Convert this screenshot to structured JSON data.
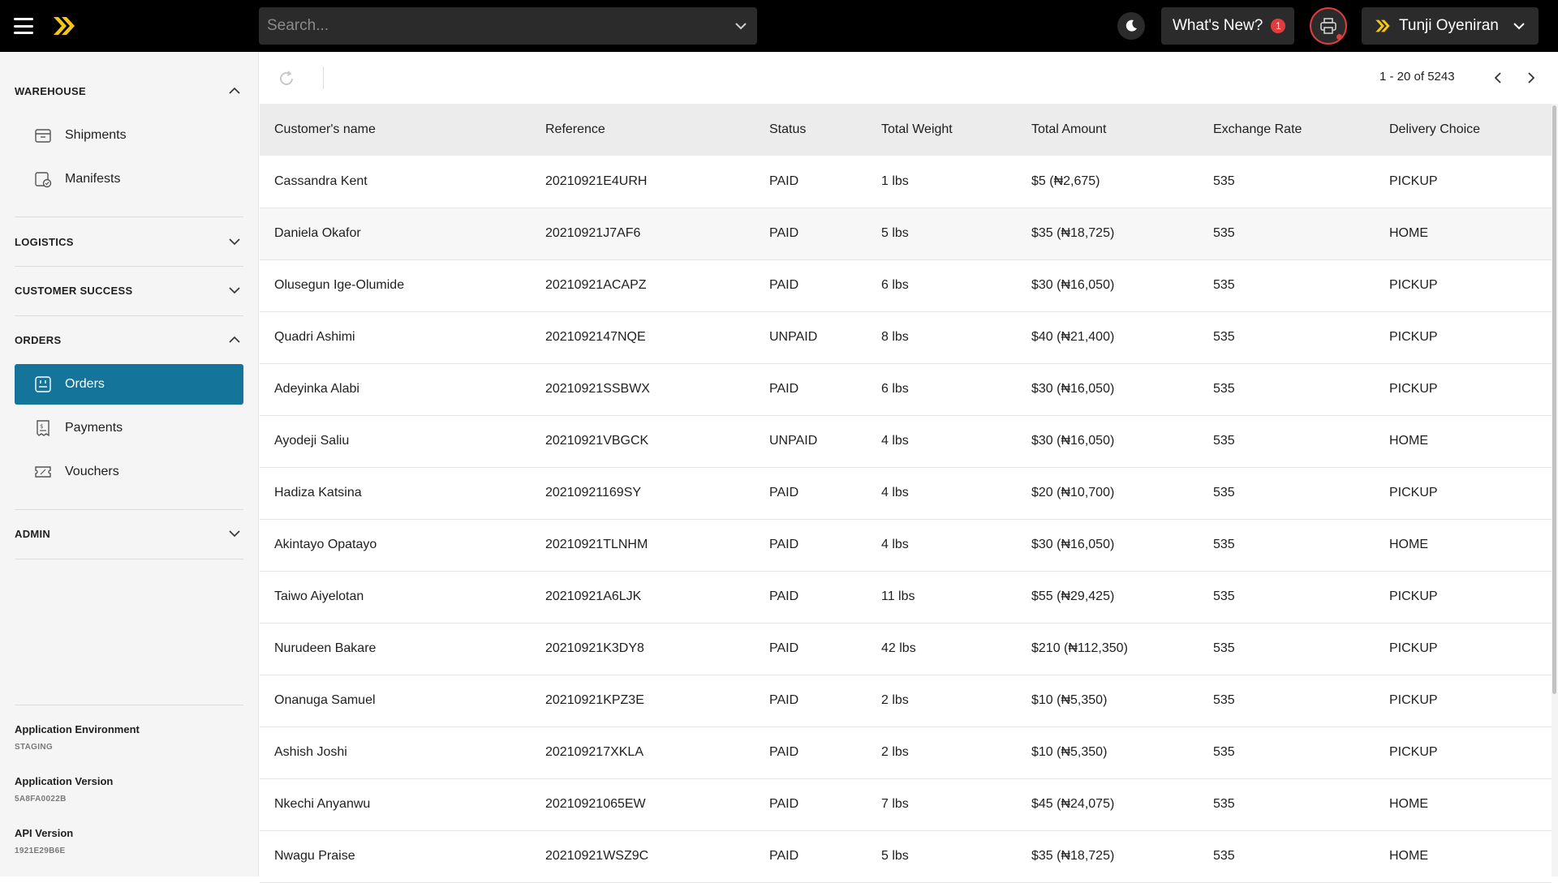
{
  "header": {
    "search_placeholder": "Search...",
    "whats_new_label": "What's New?",
    "whats_new_count": "1",
    "user_name": "Tunji Oyeniran"
  },
  "sidebar": {
    "sections": {
      "warehouse": "WAREHOUSE",
      "logistics": "LOGISTICS",
      "customer_success": "CUSTOMER SUCCESS",
      "orders": "ORDERS",
      "admin": "ADMIN"
    },
    "items": {
      "shipments": "Shipments",
      "manifests": "Manifests",
      "orders": "Orders",
      "payments": "Payments",
      "vouchers": "Vouchers"
    },
    "footer": {
      "env_label": "Application Environment",
      "env_value": "STAGING",
      "version_label": "Application Version",
      "version_value": "5A8FA0022B",
      "api_label": "API Version",
      "api_value": "1921E29B6E"
    }
  },
  "pager": {
    "text": "1 - 20 of 5243"
  },
  "table": {
    "columns": [
      "Customer's name",
      "Reference",
      "Status",
      "Total Weight",
      "Total Amount",
      "Exchange Rate",
      "Delivery Choice"
    ],
    "rows": [
      [
        "Cassandra Kent",
        "20210921E4URH",
        "PAID",
        "1 lbs",
        "$5 (₦2,675)",
        "535",
        "PICKUP"
      ],
      [
        "Daniela Okafor",
        "20210921J7AF6",
        "PAID",
        "5 lbs",
        "$35 (₦18,725)",
        "535",
        "HOME"
      ],
      [
        "Olusegun Ige-Olumide",
        "20210921ACAPZ",
        "PAID",
        "6 lbs",
        "$30 (₦16,050)",
        "535",
        "PICKUP"
      ],
      [
        "Quadri Ashimi",
        "2021092147NQE",
        "UNPAID",
        "8 lbs",
        "$40 (₦21,400)",
        "535",
        "PICKUP"
      ],
      [
        "Adeyinka Alabi",
        "20210921SSBWX",
        "PAID",
        "6 lbs",
        "$30 (₦16,050)",
        "535",
        "PICKUP"
      ],
      [
        "Ayodeji Saliu",
        "20210921VBGCK",
        "UNPAID",
        "4 lbs",
        "$30 (₦16,050)",
        "535",
        "HOME"
      ],
      [
        "Hadiza Katsina",
        "20210921169SY",
        "PAID",
        "4 lbs",
        "$20 (₦10,700)",
        "535",
        "PICKUP"
      ],
      [
        "Akintayo Opatayo",
        "20210921TLNHM",
        "PAID",
        "4 lbs",
        "$30 (₦16,050)",
        "535",
        "HOME"
      ],
      [
        "Taiwo Aiyelotan",
        "20210921A6LJK",
        "PAID",
        "11 lbs",
        "$55 (₦29,425)",
        "535",
        "PICKUP"
      ],
      [
        "Nurudeen Bakare",
        "20210921K3DY8",
        "PAID",
        "42 lbs",
        "$210 (₦112,350)",
        "535",
        "PICKUP"
      ],
      [
        "Onanuga Samuel",
        "20210921KPZ3E",
        "PAID",
        "2 lbs",
        "$10 (₦5,350)",
        "535",
        "PICKUP"
      ],
      [
        "Ashish Joshi",
        "202109217XKLA",
        "PAID",
        "2 lbs",
        "$10 (₦5,350)",
        "535",
        "PICKUP"
      ],
      [
        "Nkechi Anyanwu",
        "20210921065EW",
        "PAID",
        "7 lbs",
        "$45 (₦24,075)",
        "535",
        "HOME"
      ],
      [
        "Nwagu Praise",
        "20210921WSZ9C",
        "PAID",
        "5 lbs",
        "$35 (₦18,725)",
        "535",
        "HOME"
      ]
    ]
  },
  "colors": {
    "accent": "#15749a",
    "brand_yellow": "#f5c518",
    "alert_red": "#e03e3e"
  }
}
